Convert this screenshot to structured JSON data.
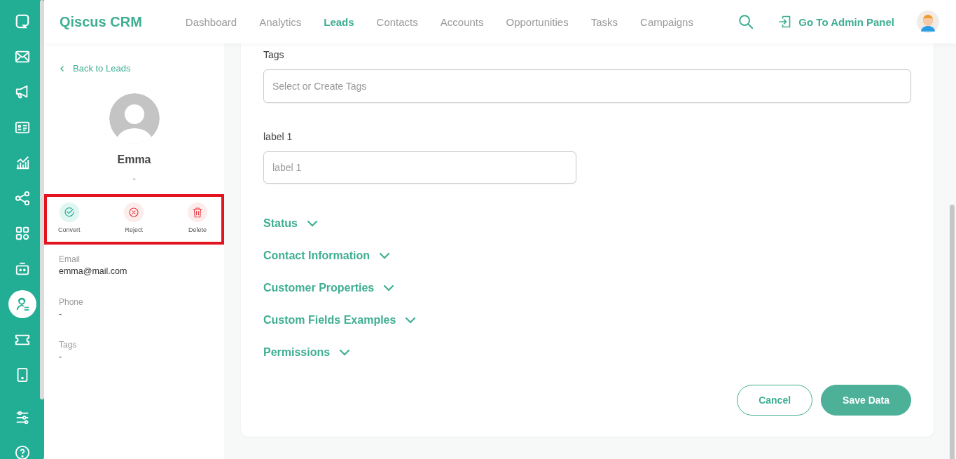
{
  "rail": {
    "items": [
      {
        "kind": "chat",
        "selected": false
      },
      {
        "kind": "mail",
        "selected": false
      },
      {
        "kind": "megaphone",
        "selected": false
      },
      {
        "kind": "card",
        "selected": false
      },
      {
        "kind": "chart",
        "selected": false
      },
      {
        "kind": "share",
        "selected": false
      },
      {
        "kind": "apps",
        "selected": false
      },
      {
        "kind": "bot",
        "selected": false
      },
      {
        "kind": "agent",
        "selected": true
      },
      {
        "kind": "ticket",
        "selected": false
      },
      {
        "kind": "phone",
        "selected": false
      },
      {
        "kind": "sliders",
        "selected": false
      },
      {
        "kind": "help",
        "selected": false
      }
    ]
  },
  "header": {
    "brand": "Qiscus CRM",
    "nav": [
      {
        "label": "Dashboard",
        "selected": false
      },
      {
        "label": "Analytics",
        "selected": false
      },
      {
        "label": "Leads",
        "selected": true
      },
      {
        "label": "Contacts",
        "selected": false
      },
      {
        "label": "Accounts",
        "selected": false
      },
      {
        "label": "Opportunities",
        "selected": false
      },
      {
        "label": "Tasks",
        "selected": false
      },
      {
        "label": "Campaigns",
        "selected": false
      }
    ],
    "admin_link": "Go To Admin Panel"
  },
  "profile": {
    "back_link": "Back to Leads",
    "name": "Emma",
    "subtitle": "-",
    "actions": [
      {
        "kind": "convert",
        "label": "Convert"
      },
      {
        "kind": "reject",
        "label": "Reject"
      },
      {
        "kind": "delete",
        "label": "Delete"
      }
    ],
    "details": [
      {
        "label": "Email",
        "value": "emma@mail.com"
      },
      {
        "label": "Phone",
        "value": "-"
      },
      {
        "label": "Tags",
        "value": "-"
      }
    ]
  },
  "form": {
    "fields": [
      {
        "label": "Tags",
        "placeholder": "Select or Create Tags",
        "wide": true
      },
      {
        "label": "label 1",
        "placeholder": "label 1",
        "wide": false
      }
    ],
    "sections": [
      {
        "title": "Status",
        "expanded": false
      },
      {
        "title": "Contact Information",
        "expanded": false
      },
      {
        "title": "Customer Properties",
        "expanded": false
      },
      {
        "title": "Custom Fields Examples",
        "expanded": false
      },
      {
        "title": "Permissions",
        "expanded": false
      }
    ],
    "buttons": [
      {
        "kind": "secondary",
        "label": "Cancel"
      },
      {
        "kind": "primary",
        "label": "Save Data"
      }
    ]
  }
}
